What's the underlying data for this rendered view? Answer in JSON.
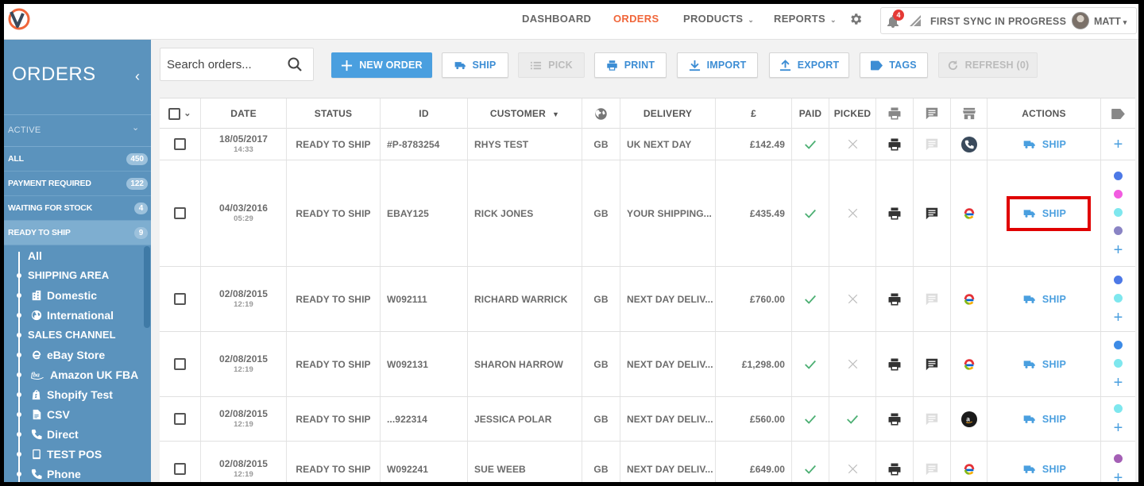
{
  "nav": {
    "links": [
      {
        "label": "DASHBOARD",
        "active": false,
        "dropdown": false
      },
      {
        "label": "ORDERS",
        "active": true,
        "dropdown": false
      },
      {
        "label": "PRODUCTS",
        "active": false,
        "dropdown": true
      },
      {
        "label": "REPORTS",
        "active": false,
        "dropdown": true
      }
    ],
    "notification_count": "4",
    "sync_status": "FIRST SYNC IN PROGRESS",
    "user": "MATT",
    "accent_color": "#f0663a"
  },
  "sidebar": {
    "title": "ORDERS",
    "section": "ACTIVE",
    "filters": [
      {
        "label": "ALL",
        "count": "450"
      },
      {
        "label": "PAYMENT REQUIRED",
        "count": "122"
      },
      {
        "label": "WAITING FOR STOCK",
        "count": "4"
      },
      {
        "label": "READY TO SHIP",
        "count": "9"
      }
    ],
    "tree": {
      "all": "All",
      "shipping_area": "SHIPPING AREA",
      "shipping": [
        {
          "label": "Domestic",
          "icon": "building-icon"
        },
        {
          "label": "International",
          "icon": "globe-icon"
        }
      ],
      "sales_channel": "SALES CHANNEL",
      "channels": [
        {
          "label": "eBay Store",
          "icon": "ebay-icon"
        },
        {
          "label": "Amazon UK FBA",
          "icon": "fba-icon"
        },
        {
          "label": "Shopify Test",
          "icon": "shopify-icon"
        },
        {
          "label": "CSV",
          "icon": "file-icon"
        },
        {
          "label": "Direct",
          "icon": "phone-icon"
        },
        {
          "label": "TEST POS",
          "icon": "tablet-icon"
        },
        {
          "label": "Phone",
          "icon": "phone-icon"
        }
      ]
    }
  },
  "toolbar": {
    "search_placeholder": "Search orders...",
    "new_order": "NEW ORDER",
    "ship": "SHIP",
    "pick": "PICK",
    "print": "PRINT",
    "import": "IMPORT",
    "export": "EXPORT",
    "tags": "TAGS",
    "refresh": "REFRESH (0)"
  },
  "table": {
    "columns": {
      "date": "DATE",
      "status": "STATUS",
      "id": "ID",
      "customer": "CUSTOMER",
      "delivery": "DELIVERY",
      "currency": "£",
      "paid": "PAID",
      "picked": "PICKED",
      "actions": "ACTIONS"
    },
    "action_label": "SHIP",
    "rows": [
      {
        "date": "18/05/2017",
        "time": "14:33",
        "status": "READY TO SHIP",
        "id": "#P-8783254",
        "customer": "RHYS TEST",
        "country": "GB",
        "delivery": "UK NEXT DAY",
        "total": "£142.49",
        "paid": true,
        "picked": false,
        "note": false,
        "channel": "phone",
        "tags": [],
        "highlight": false
      },
      {
        "date": "04/03/2016",
        "time": "05:29",
        "status": "READY TO SHIP",
        "id": "EBAY125",
        "customer": "RICK JONES",
        "country": "GB",
        "delivery": "YOUR SHIPPING...",
        "total": "£435.49",
        "paid": true,
        "picked": false,
        "note": true,
        "channel": "ebay",
        "tags": [
          "#4d79e6",
          "#f25ce0",
          "#7ee7ee",
          "#8a84c4"
        ],
        "highlight": true
      },
      {
        "date": "02/08/2015",
        "time": "12:19",
        "status": "READY TO SHIP",
        "id": "W092111",
        "customer": "RICHARD WARRICK",
        "country": "GB",
        "delivery": "NEXT DAY DELIV...",
        "total": "£760.00",
        "paid": true,
        "picked": false,
        "note": false,
        "channel": "ebay",
        "tags": [
          "#4d79e6",
          "#7ee7ee"
        ],
        "highlight": false
      },
      {
        "date": "02/08/2015",
        "time": "12:19",
        "status": "READY TO SHIP",
        "id": "W092131",
        "customer": "SHARON HARROW",
        "country": "GB",
        "delivery": "NEXT DAY DELIV...",
        "total": "£1,298.00",
        "paid": true,
        "picked": false,
        "note": true,
        "channel": "ebay",
        "tags": [
          "#3d8be6",
          "#7ee7ee"
        ],
        "highlight": false
      },
      {
        "date": "02/08/2015",
        "time": "12:19",
        "status": "READY TO SHIP",
        "id": "...922314",
        "customer": "JESSICA POLAR",
        "country": "GB",
        "delivery": "NEXT DAY DELIV...",
        "total": "£560.00",
        "paid": true,
        "picked": true,
        "note": false,
        "channel": "amazon",
        "tags": [
          "#7ee7ee"
        ],
        "highlight": false
      },
      {
        "date": "02/08/2015",
        "time": "12:19",
        "status": "READY TO SHIP",
        "id": "W092241",
        "customer": "SUE WEEB",
        "country": "GB",
        "delivery": "NEXT DAY DELIV...",
        "total": "£649.00",
        "paid": true,
        "picked": false,
        "note": false,
        "channel": "ebay",
        "tags": [
          "#a45fb5"
        ],
        "highlight": false
      }
    ]
  }
}
